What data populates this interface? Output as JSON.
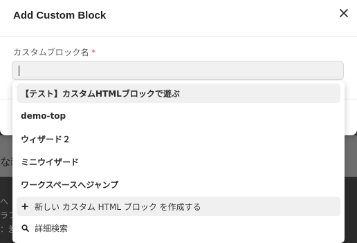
{
  "modal": {
    "title": "Add Custom Block",
    "close_icon": "close-icon"
  },
  "field": {
    "label": "カスタムブロック名",
    "required_mark": "*",
    "value": "",
    "placeholder": ""
  },
  "dropdown": {
    "options": [
      {
        "label": "【テスト】カスタムHTMLブロックで遊ぶ",
        "highlighted": true
      },
      {
        "label": "demo-top",
        "highlighted": false
      },
      {
        "label": "ウィザード２",
        "highlighted": false
      },
      {
        "label": "ミニウイザード",
        "highlighted": false
      },
      {
        "label": "ワークスペースへジャンプ",
        "highlighted": false
      }
    ],
    "create_label": "新しい カスタム HTML ブロック を作成する",
    "create_icon": "plus-icon",
    "search_label": "詳細検索",
    "search_icon": "search-icon"
  },
  "background": {
    "text_1": "な装",
    "text_2": "へ",
    "text_3": "ラフ",
    "text_4": "：差"
  }
}
